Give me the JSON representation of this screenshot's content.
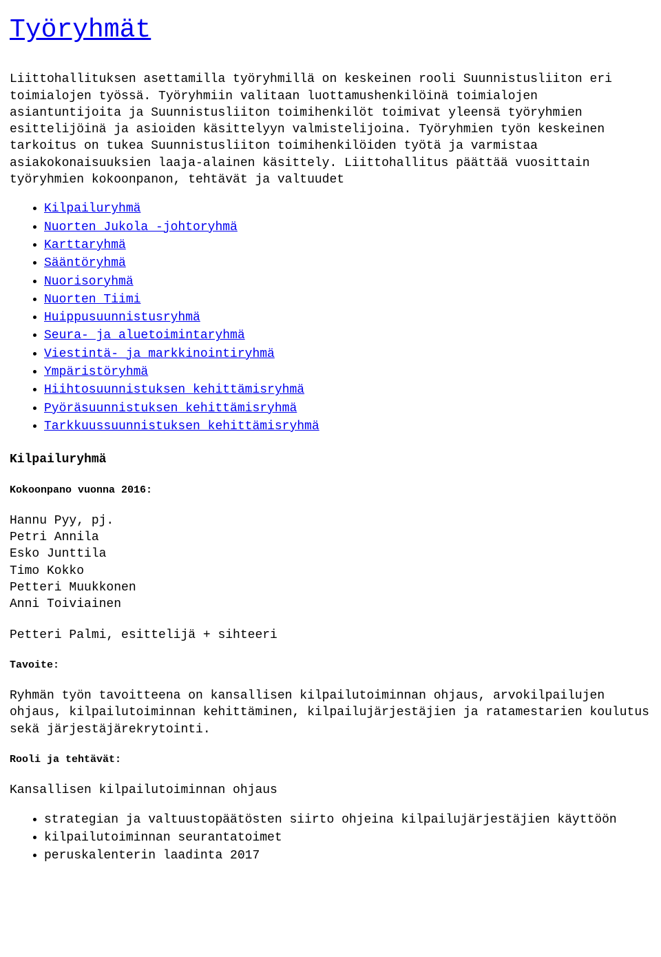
{
  "title": "Työryhmät",
  "intro": "Liittohallituksen asettamilla työryhmillä on keskeinen rooli Suunnistusliiton eri toimialojen työssä. Työryhmiin valitaan luottamushenkilöinä toimialojen asiantuntijoita ja Suunnistusliiton toimihenkilöt toimivat yleensä työryhmien esittelijöinä ja asioiden käsittelyyn valmistelijoina. Työryhmien työn keskeinen tarkoitus on tukea Suunnistusliiton toimihenkilöiden työtä ja varmistaa asiakokonaisuuksien laaja-alainen käsittely. Liittohallitus päättää vuosittain työryhmien kokoonpanon, tehtävät ja valtuudet",
  "group_links": [
    "Kilpailuryhmä",
    "Nuorten Jukola -johtoryhmä",
    "Karttaryhmä",
    "Sääntöryhmä",
    "Nuorisoryhmä",
    "Nuorten Tiimi",
    "Huippusuunnistusryhmä",
    "Seura- ja aluetoimintaryhmä",
    "Viestintä- ja markkinointiryhmä",
    "Ympäristöryhmä",
    "Hiihtosuunnistuksen kehittämisryhmä",
    "Pyöräsuunnistuksen kehittämisryhmä",
    "Tarkkuussuunnistuksen kehittämisryhmä"
  ],
  "section": {
    "name": "Kilpailuryhmä",
    "composition_label": "Kokoonpano vuonna 2016:",
    "members": [
      "Hannu Pyy, pj.",
      "Petri Annila",
      "Esko Junttila",
      "Timo Kokko",
      "Petteri Muukkonen",
      "Anni Toiviainen"
    ],
    "secretary": "Petteri Palmi, esittelijä + sihteeri",
    "goal_label": "Tavoite:",
    "goal_text": "Ryhmän työn tavoitteena on kansallisen kilpailutoiminnan ohjaus, arvokilpailujen ohjaus, kilpailutoiminnan kehittäminen, kilpailujärjestäjien ja ratamestarien koulutus sekä järjestäjärekrytointi.",
    "tasks_label": "Rooli ja tehtävät:",
    "tasks_heading": "Kansallisen kilpailutoiminnan ohjaus",
    "tasks": [
      "strategian ja valtuustopäätösten siirto ohjeina kilpailujärjestäjien käyttöön",
      "kilpailutoiminnan seurantatoimet",
      "peruskalenterin laadinta 2017"
    ]
  }
}
